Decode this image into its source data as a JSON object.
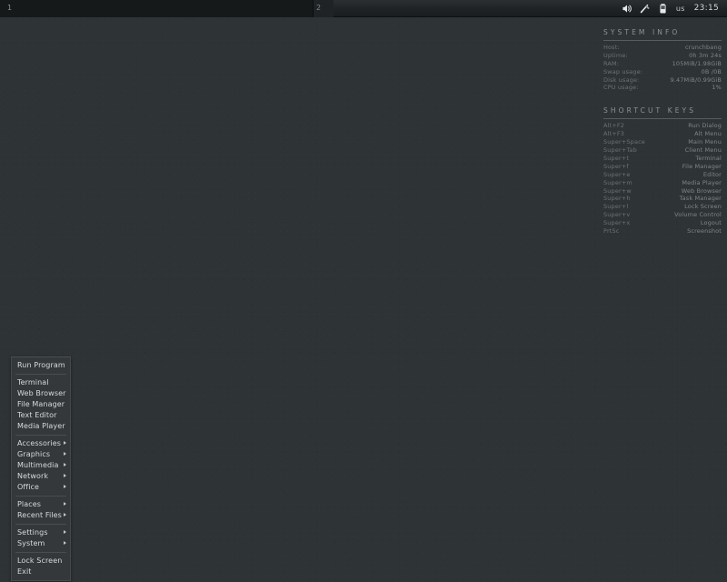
{
  "panel": {
    "desktops": [
      {
        "name": "desktop-1",
        "label": "1",
        "active": true
      },
      {
        "name": "desktop-2",
        "label": "2",
        "active": false
      }
    ],
    "tray": [
      {
        "icon": "volume-icon"
      },
      {
        "icon": "network-icon"
      },
      {
        "icon": "battery-icon"
      }
    ],
    "keyboard_layout": "us",
    "clock": "23:15"
  },
  "conky": {
    "system_info": {
      "heading": "SYSTEM INFO",
      "rows": [
        {
          "key": "Host:",
          "value": "crunchbang"
        },
        {
          "key": "Uptime:",
          "value": "0h 3m 24s"
        },
        {
          "key": "RAM:",
          "value": "105MiB/1.98GiB"
        },
        {
          "key": "Swap usage:",
          "value": "0B /0B"
        },
        {
          "key": "Disk usage:",
          "value": "9.47MiB/0.99GiB"
        },
        {
          "key": "CPU usage:",
          "value": "1%"
        }
      ]
    },
    "shortcut_keys": {
      "heading": "SHORTCUT KEYS",
      "rows": [
        {
          "key": "Alt+F2",
          "value": "Run Dialog"
        },
        {
          "key": "Alt+F3",
          "value": "Alt Menu"
        },
        {
          "key": "Super+Space",
          "value": "Main Menu"
        },
        {
          "key": "Super+Tab",
          "value": "Client Menu"
        },
        {
          "key": "Super+t",
          "value": "Terminal"
        },
        {
          "key": "Super+f",
          "value": "File Manager"
        },
        {
          "key": "Super+e",
          "value": "Editor"
        },
        {
          "key": "Super+m",
          "value": "Media Player"
        },
        {
          "key": "Super+w",
          "value": "Web Browser"
        },
        {
          "key": "Super+h",
          "value": "Task Manager"
        },
        {
          "key": "Super+l",
          "value": "Lock Screen"
        },
        {
          "key": "Super+v",
          "value": "Volume Control"
        },
        {
          "key": "Super+x",
          "value": "Logout"
        },
        {
          "key": "PrtSc",
          "value": "Screenshot"
        }
      ]
    }
  },
  "root_menu": {
    "groups": [
      {
        "items": [
          {
            "label": "Run Program",
            "submenu": false
          }
        ]
      },
      {
        "items": [
          {
            "label": "Terminal",
            "submenu": false
          },
          {
            "label": "Web Browser",
            "submenu": false
          },
          {
            "label": "File Manager",
            "submenu": false
          },
          {
            "label": "Text Editor",
            "submenu": false
          },
          {
            "label": "Media Player",
            "submenu": false
          }
        ]
      },
      {
        "items": [
          {
            "label": "Accessories",
            "submenu": true
          },
          {
            "label": "Graphics",
            "submenu": true
          },
          {
            "label": "Multimedia",
            "submenu": true
          },
          {
            "label": "Network",
            "submenu": true
          },
          {
            "label": "Office",
            "submenu": true
          }
        ]
      },
      {
        "items": [
          {
            "label": "Places",
            "submenu": true
          },
          {
            "label": "Recent Files",
            "submenu": true
          }
        ]
      },
      {
        "items": [
          {
            "label": "Settings",
            "submenu": true
          },
          {
            "label": "System",
            "submenu": true
          }
        ]
      },
      {
        "items": [
          {
            "label": "Lock Screen",
            "submenu": false
          },
          {
            "label": "Exit",
            "submenu": false
          }
        ]
      }
    ]
  },
  "colors": {
    "desktop_bg": "#2e3436",
    "panel_bg": "#202325",
    "menu_bg": "#34383a",
    "menu_text": "#d6dadb",
    "conky_text": "#6f7678",
    "conky_heading": "#8d9496"
  }
}
